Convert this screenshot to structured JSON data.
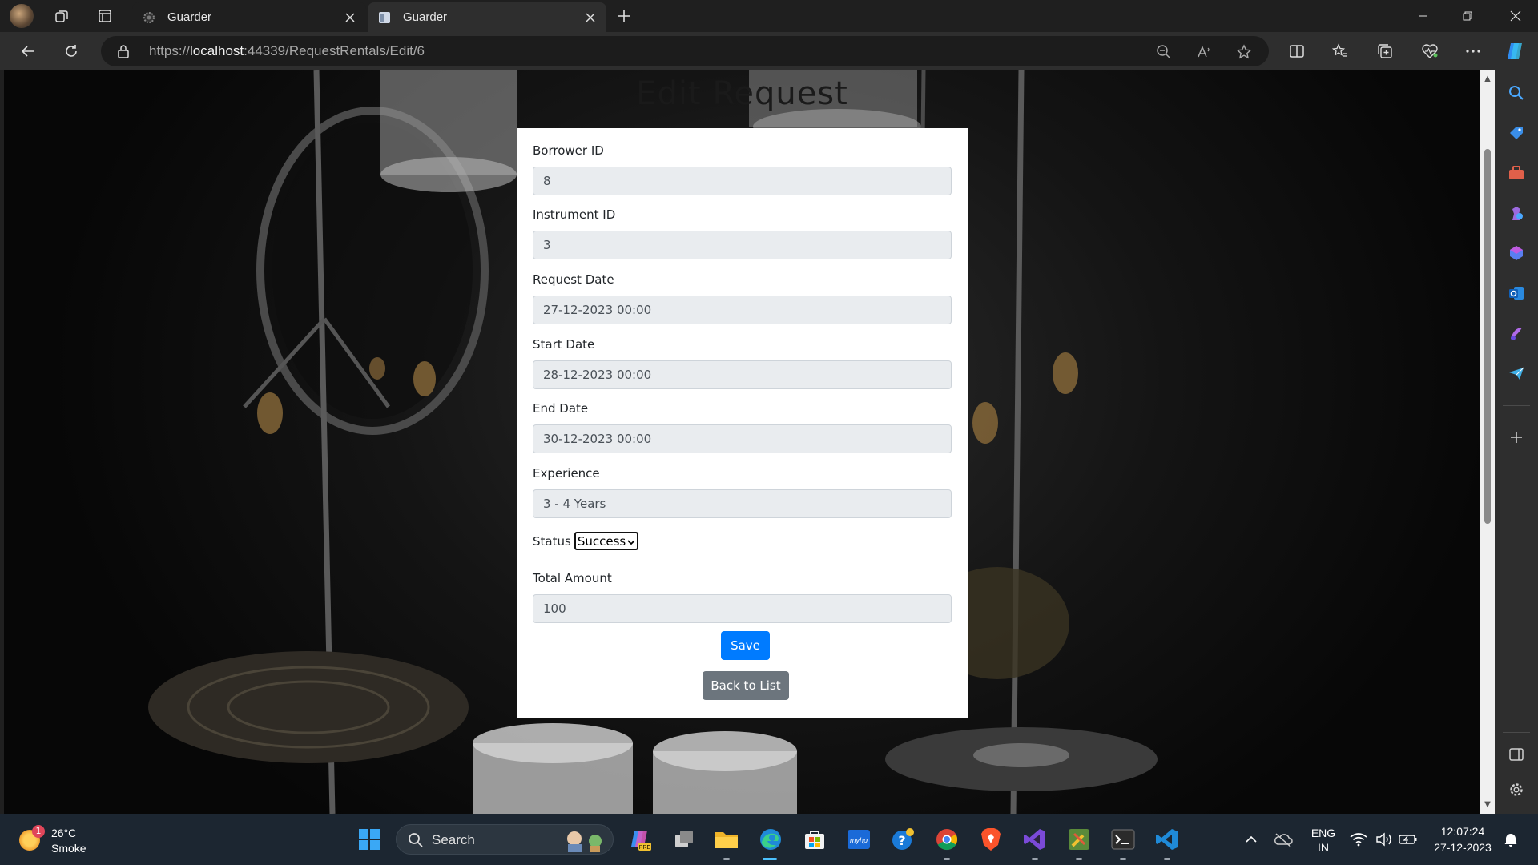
{
  "browser": {
    "tabs": [
      {
        "title": "Guarder",
        "active": false
      },
      {
        "title": "Guarder",
        "active": true
      }
    ],
    "url_prefix": "https://",
    "url_host": "localhost",
    "url_rest": ":44339/RequestRentals/Edit/6"
  },
  "page": {
    "heading": "Edit Request",
    "fields": {
      "borrower_id": {
        "label": "Borrower ID",
        "value": "8"
      },
      "instrument_id": {
        "label": "Instrument ID",
        "value": "3"
      },
      "request_date": {
        "label": "Request Date",
        "value": "27-12-2023 00:00"
      },
      "start_date": {
        "label": "Start Date",
        "value": "28-12-2023 00:00"
      },
      "end_date": {
        "label": "End Date",
        "value": "30-12-2023 00:00"
      },
      "experience": {
        "label": "Experience",
        "value": "3 - 4 Years"
      },
      "status": {
        "label": "Status",
        "value": "Success"
      },
      "total_amount": {
        "label": "Total Amount",
        "value": "100"
      }
    },
    "save_label": "Save",
    "back_label": "Back to List"
  },
  "taskbar": {
    "weather_badge": "1",
    "weather_temp": "26°C",
    "weather_condition": "Smoke",
    "search_label": "Search",
    "lang_line1": "ENG",
    "lang_line2": "IN",
    "time": "12:07:24",
    "date": "27-12-2023"
  },
  "colors": {
    "primary_button": "#007bff",
    "secondary_button": "#6c757d",
    "readonly_input": "#e9ecef"
  }
}
